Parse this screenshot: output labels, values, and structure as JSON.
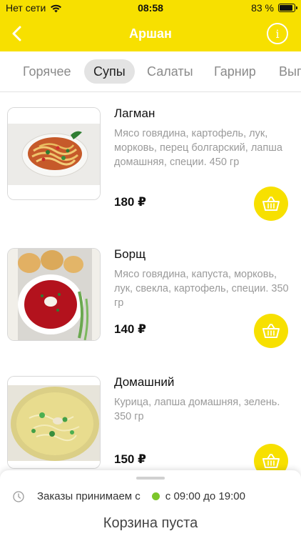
{
  "status_bar": {
    "carrier": "Нет сети",
    "time": "08:58",
    "battery": "83 %",
    "battery_level": 0.83
  },
  "nav": {
    "title": "Аршан",
    "info_icon": "i"
  },
  "tabs": [
    {
      "label": "Горячее",
      "active": false
    },
    {
      "label": "Супы",
      "active": true
    },
    {
      "label": "Салаты",
      "active": false
    },
    {
      "label": "Гарнир",
      "active": false
    },
    {
      "label": "Вып",
      "active": false
    }
  ],
  "items": [
    {
      "name": "Лагман",
      "description": "Мясо говядина, картофель, лук, морковь, перец болгарский, лапша домашняя, специи. 450 гр",
      "price": "180 ₽",
      "image": "lagman-dish"
    },
    {
      "name": "Борщ",
      "description": "Мясо говядина, капуста, морковь, лук, свекла, картофель, специи. 350 гр",
      "price": "140 ₽",
      "image": "borscht-dish"
    },
    {
      "name": "Домашний",
      "description": "Курица, лапша домашняя, зелень. 350 гр",
      "price": "150 ₽",
      "image": "chicken-noodle-dish"
    }
  ],
  "bottom": {
    "hours_label": "Заказы принимаем с",
    "hours_value": "с 09:00 до 19:00",
    "cart_status": "Корзина пуста"
  },
  "colors": {
    "accent": "#f7e000",
    "open_status": "#7cc62a"
  }
}
